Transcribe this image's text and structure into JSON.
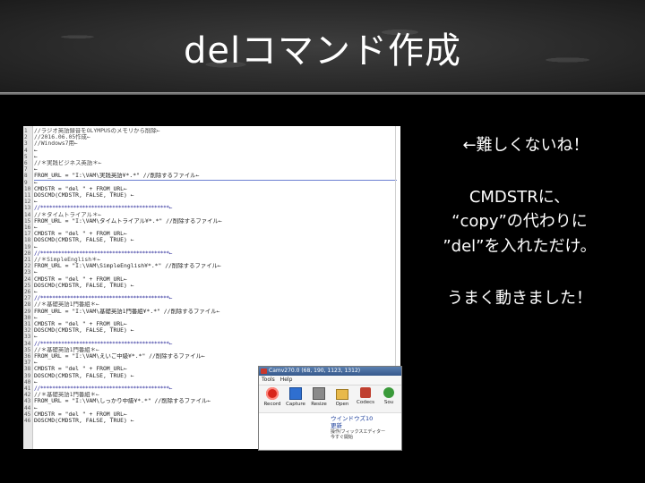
{
  "slide": {
    "title": "delコマンド作成"
  },
  "notes": {
    "line1": "←難しくないね！",
    "line2": "CMDSTRに、",
    "line3": "“copy”の代わりに",
    "line4": "”del”を入れただけ。",
    "line5": "うまく動きました！"
  },
  "editor": {
    "line_numbers": [
      "1",
      "2",
      "3",
      "4",
      "5",
      "6",
      "7",
      "8",
      "9",
      "10",
      "11",
      "12",
      "13",
      "14",
      "15",
      "16",
      "17",
      "18",
      "19",
      "20",
      "21",
      "22",
      "23",
      "24",
      "25",
      "26",
      "27",
      "28",
      "29",
      "30",
      "31",
      "32",
      "33",
      "34",
      "35",
      "36",
      "37",
      "38",
      "39",
      "40",
      "41",
      "42",
      "43",
      "44",
      "45",
      "46",
      "47",
      "48",
      "49",
      "50"
    ],
    "lines": [
      "//ラジオ英語録音をOLYMPUSのメモリから削除←",
      "//2016.06.05作成←",
      "//Windows7用←",
      "←",
      "←",
      "//＊実践ビジネス英語＊←",
      "←",
      "FROM_URL = \"I:\\VAM\\実践英語¥*.*\"   //削除するファイル←",
      "←",
      "CMDSTR = \"del \" + FROM_URL←",
      "DOSCMD(CMDSTR, FALSE, TRUE) ←",
      "←",
      "//*******************************************←",
      "//＊タイムトライアル＊←",
      "FROM_URL = \"I:\\VAM\\タイムトライアル¥*.*\"   //削除するファイル←",
      "←",
      "CMDSTR = \"del \" + FROM_URL←",
      "DOSCMD(CMDSTR, FALSE, TRUE) ←",
      "←",
      "//*******************************************←",
      "//＊SimpleEnglish＊←",
      "FROM_URL = \"I:\\VAM\\SimpleEnglish¥*.*\"   //削除するファイル←",
      "←",
      "CMDSTR = \"del \" + FROM_URL←",
      "DOSCMD(CMDSTR, FALSE, TRUE) ←",
      "←",
      "//*******************************************←",
      "//＊基礎英語1門番組＊←",
      "FROM_URL = \"I:\\VAM\\基礎英語1門番組¥*.*\"   //削除するファイル←",
      "←",
      "CMDSTR = \"del \" + FROM_URL←",
      "DOSCMD(CMDSTR, FALSE, TRUE) ←",
      "←",
      "//*******************************************←",
      "//＊基礎英語1門番組＊←",
      "FROM_URL = \"I:\\VAM\\えいご中級¥*.*\"   //削除するファイル←",
      "←",
      "CMDSTR = \"del \" + FROM_URL←",
      "DOSCMD(CMDSTR, FALSE, TRUE) ←",
      "←",
      "//*******************************************←",
      "//＊基礎英語1門番組＊←",
      "FROM_URL = \"I:\\VAM\\しっかり中級¥*.*\"   //削除するファイル←",
      "←",
      "CMDSTR = \"del \" + FROM_URL←",
      "DOSCMD(CMDSTR, FALSE, TRUE) ←"
    ]
  },
  "camtasia": {
    "title": "Camv270.0 (68, 190, 1123, 1312)",
    "menu": [
      "Tools",
      "Help"
    ],
    "tools": [
      "Record",
      "Capture",
      "Resize",
      "Open",
      "Codecs",
      "Sou"
    ],
    "balloon_title": "ウインドウズ10",
    "balloon_sub": "更新",
    "balloon_text1": "操作/フィックスエディター",
    "balloon_text2": "今すぐ開始"
  }
}
